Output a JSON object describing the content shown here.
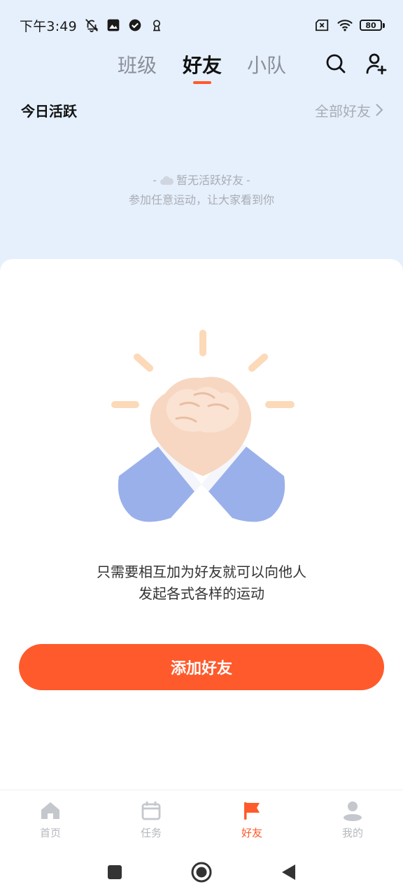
{
  "status_bar": {
    "time": "下午3:49",
    "battery_level": "80"
  },
  "tabs": [
    {
      "label": "班级",
      "active": false
    },
    {
      "label": "好友",
      "active": true
    },
    {
      "label": "小队",
      "active": false
    }
  ],
  "today_active": {
    "title": "今日活跃",
    "all_friends_link": "全部好友",
    "empty_title": "暂无活跃好友",
    "empty_subtitle": "参加任意运动，让大家看到你"
  },
  "empty_state": {
    "line1": "只需要相互加为好友就可以向他人",
    "line2": "发起各式各样的运动",
    "button_label": "添加好友"
  },
  "bottom_nav": [
    {
      "label": "首页",
      "icon": "home-icon",
      "active": false
    },
    {
      "label": "任务",
      "icon": "calendar-icon",
      "active": false
    },
    {
      "label": "好友",
      "icon": "flag-icon",
      "active": true
    },
    {
      "label": "我的",
      "icon": "person-icon",
      "active": false
    }
  ],
  "colors": {
    "accent": "#ff5a2b",
    "header_bg": "#e6f0fd",
    "muted_text": "#a9adb4"
  }
}
